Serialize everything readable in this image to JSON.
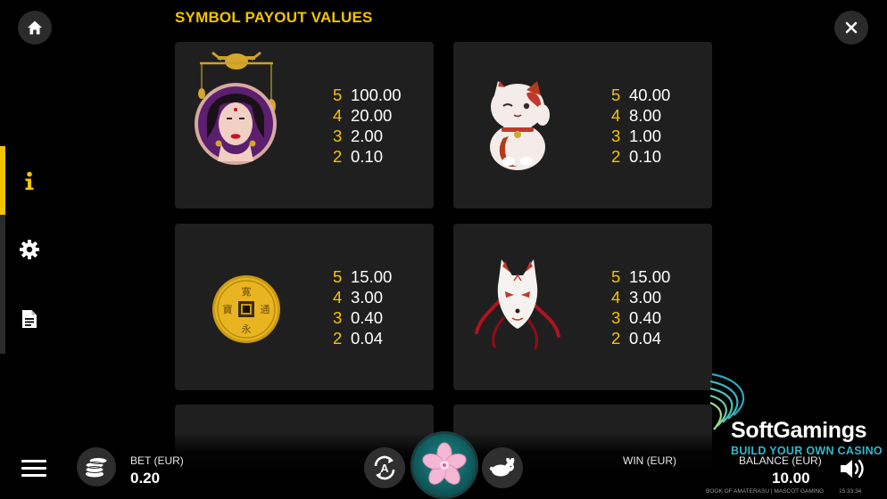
{
  "header": {
    "title": "SYMBOL PAYOUT VALUES"
  },
  "nav": {
    "home_icon": "home-icon",
    "close_icon": "close-icon",
    "side_items": [
      {
        "name": "info",
        "icon": "info-icon",
        "active": true
      },
      {
        "name": "settings",
        "icon": "gear-icon",
        "active": false
      },
      {
        "name": "rules",
        "icon": "document-icon",
        "active": false
      }
    ]
  },
  "symbols": [
    {
      "name": "geisha",
      "icon": "geisha-symbol",
      "pays": [
        {
          "count": "5",
          "value": "100.00"
        },
        {
          "count": "4",
          "value": "20.00"
        },
        {
          "count": "3",
          "value": "2.00"
        },
        {
          "count": "2",
          "value": "0.10"
        }
      ]
    },
    {
      "name": "lucky-cat",
      "icon": "lucky-cat-symbol",
      "pays": [
        {
          "count": "5",
          "value": "40.00"
        },
        {
          "count": "4",
          "value": "8.00"
        },
        {
          "count": "3",
          "value": "1.00"
        },
        {
          "count": "2",
          "value": "0.10"
        }
      ]
    },
    {
      "name": "coin",
      "icon": "coin-symbol",
      "pays": [
        {
          "count": "5",
          "value": "15.00"
        },
        {
          "count": "4",
          "value": "3.00"
        },
        {
          "count": "3",
          "value": "0.40"
        },
        {
          "count": "2",
          "value": "0.04"
        }
      ]
    },
    {
      "name": "fox-mask",
      "icon": "fox-mask-symbol",
      "pays": [
        {
          "count": "5",
          "value": "15.00"
        },
        {
          "count": "4",
          "value": "3.00"
        },
        {
          "count": "3",
          "value": "0.40"
        },
        {
          "count": "2",
          "value": "0.04"
        }
      ]
    }
  ],
  "coin_glyphs": {
    "top": "寛",
    "left": "寶",
    "right": "通",
    "bottom": "永"
  },
  "bottom_bar": {
    "bet_label": "BET (EUR)",
    "bet_value": "0.20",
    "win_label": "WIN (EUR)",
    "balance_label": "BALANCE (EUR)",
    "balance_value": "10.00",
    "autoplay_letter": "A",
    "game_credit": "BOOK OF AMATERASU | MASCOT GAMING",
    "clock": "15:33:34"
  },
  "watermark": {
    "name": "SoftGamings",
    "tagline": "BUILD YOUR OWN CASINO"
  },
  "colors": {
    "accent": "#f5c400",
    "card": "#1f1f1f",
    "spin": "#1f8c8c",
    "brand": "#35b6c9"
  }
}
